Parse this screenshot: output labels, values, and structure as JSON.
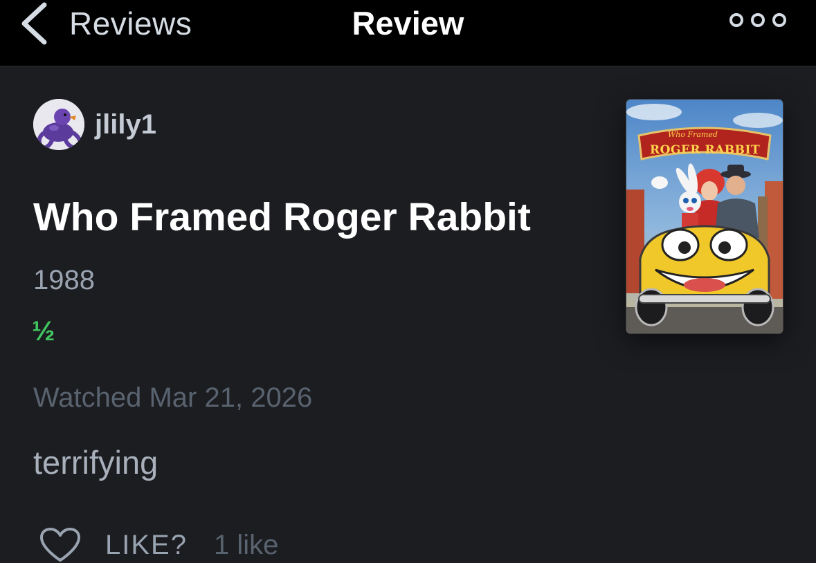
{
  "nav": {
    "back_label": "Reviews",
    "title": "Review",
    "more_icon": "more-dots-icon"
  },
  "review": {
    "username": "jlily1",
    "film_title": "Who Framed Roger Rabbit",
    "year": "1988",
    "rating": "½",
    "watched": "Watched Mar 21, 2026",
    "text": "terrifying",
    "like_label": "LIKE?",
    "like_count": "1 like"
  },
  "poster": {
    "title_small": "Who Framed",
    "title_big": "ROGER RABBIT"
  },
  "colors": {
    "background": "#1c1d21",
    "navbar": "#000000",
    "rating_green": "#40c660",
    "muted_text": "#59636f"
  }
}
